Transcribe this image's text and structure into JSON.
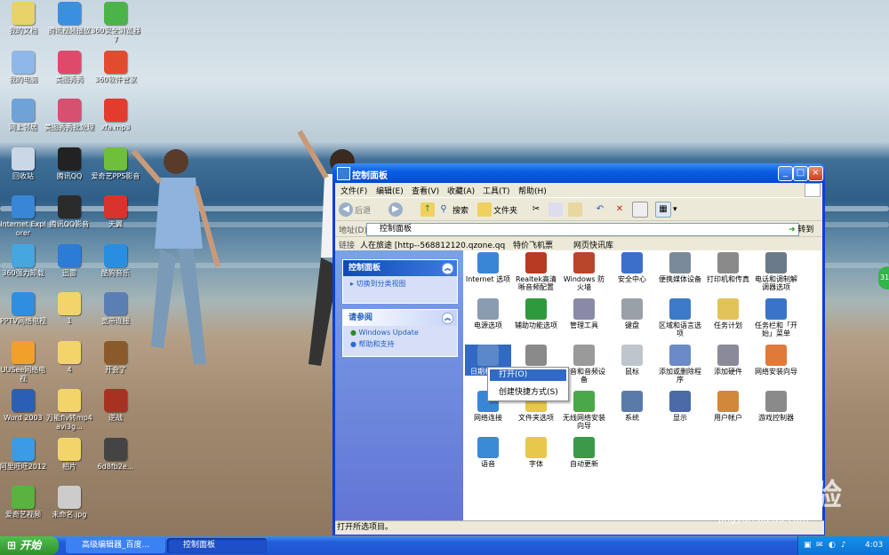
{
  "desktop_icons": [
    {
      "label": "我的文档",
      "color": "#e8d26a"
    },
    {
      "label": "我的电脑",
      "color": "#8fb8e8"
    },
    {
      "label": "网上邻居",
      "color": "#6fa3d8"
    },
    {
      "label": "回收站",
      "color": "#c9d7e6"
    },
    {
      "label": "Internet Explorer",
      "color": "#3a86d6"
    },
    {
      "label": "360强力卸载",
      "color": "#45a6e0"
    },
    {
      "label": "PPTV网络电视",
      "color": "#2f8ee0"
    },
    {
      "label": "UUSee网络电视",
      "color": "#f1a12b"
    },
    {
      "label": "Word 2003",
      "color": "#2b5fb5"
    },
    {
      "label": "阿里旺旺2012",
      "color": "#3b9be6"
    },
    {
      "label": "爱奇艺视频",
      "color": "#5ab33e"
    },
    {
      "label": "腾讯视频播放",
      "color": "#3a8fe0"
    },
    {
      "label": "美图秀秀",
      "color": "#e04a6a"
    },
    {
      "label": "美图秀秀批处理",
      "color": "#d6506f"
    },
    {
      "label": "腾讯QQ",
      "color": "#222222"
    },
    {
      "label": "腾讯QQ影音",
      "color": "#2b2b2b"
    },
    {
      "label": "迅雷",
      "color": "#2c7bd6"
    },
    {
      "label": "1",
      "color": "#f2d46b"
    },
    {
      "label": "4",
      "color": "#f2d46b"
    },
    {
      "label": "万能flv转mp4avi3g...",
      "color": "#f2d46b"
    },
    {
      "label": "相片",
      "color": "#f2d46b"
    },
    {
      "label": "未命名.jpg",
      "color": "#cccccc"
    },
    {
      "label": "360安全浏览器7",
      "color": "#4bb449"
    },
    {
      "label": "360软件管家",
      "color": "#e34b2e"
    },
    {
      "label": "xfa.mp3",
      "color": "#e33b2e"
    },
    {
      "label": "爱奇艺PPS影音",
      "color": "#6fbf3b"
    },
    {
      "label": "天翼",
      "color": "#d9342b"
    },
    {
      "label": "酷狗音乐",
      "color": "#2a8ee0"
    },
    {
      "label": "宽带连接",
      "color": "#5b7fb5"
    },
    {
      "label": "开会了",
      "color": "#8a5a2b"
    },
    {
      "label": "逆战",
      "color": "#a83222"
    },
    {
      "label": "6d8fb2e...",
      "color": "#444444"
    }
  ],
  "window": {
    "title": "控制面板",
    "menu": [
      "文件(F)",
      "编辑(E)",
      "查看(V)",
      "收藏(A)",
      "工具(T)",
      "帮助(H)"
    ],
    "toolbar": {
      "back": "后退",
      "search": "搜索",
      "folders": "文件夹"
    },
    "address_label": "地址(D)",
    "address_value": "控制面板",
    "go_label": "转到",
    "links_label": "链接",
    "links": [
      "人在旅途 [http--568812120.qzone.qq",
      "特价飞机票",
      "网页快讯库"
    ],
    "side": {
      "cp_title": "控制面板",
      "cp_switch": "切换到分类视图",
      "see_also_title": "请参阅",
      "see_also_items": [
        "Windows Update",
        "帮助和支持"
      ]
    },
    "items": [
      {
        "label": "Internet 选项",
        "color": "#3a86d6"
      },
      {
        "label": "Realtek高清晰音频配置",
        "color": "#b83a22"
      },
      {
        "label": "Windows 防火墙",
        "color": "#b9452a"
      },
      {
        "label": "安全中心",
        "color": "#3b6fc9"
      },
      {
        "label": "便携媒体设备",
        "color": "#7a8a9a"
      },
      {
        "label": "打印机和传真",
        "color": "#8a8a8a"
      },
      {
        "label": "电话和调制解调器选项",
        "color": "#6a7a8a"
      },
      {
        "label": "电源选项",
        "color": "#8a9cb0"
      },
      {
        "label": "辅助功能选项",
        "color": "#2f9a3c"
      },
      {
        "label": "管理工具",
        "color": "#8a8aa8"
      },
      {
        "label": "键盘",
        "color": "#9aa0a8"
      },
      {
        "label": "区域和语言选项",
        "color": "#3d7ac8"
      },
      {
        "label": "任务计划",
        "color": "#e2c25a"
      },
      {
        "label": "任务栏和「开始」菜单",
        "color": "#3a74c8"
      },
      {
        "label": "日期和时间",
        "color": "#5a88c8"
      },
      {
        "label": "扫描仪和照相机",
        "color": "#8a8a8a"
      },
      {
        "label": "声音和音频设备",
        "color": "#9a9a9a"
      },
      {
        "label": "鼠标",
        "color": "#bfc5cc"
      },
      {
        "label": "添加或删除程序",
        "color": "#6a8ac8"
      },
      {
        "label": "添加硬件",
        "color": "#8a8a9a"
      },
      {
        "label": "网络安装向导",
        "color": "#e07a3a"
      },
      {
        "label": "网络连接",
        "color": "#3a86d6"
      },
      {
        "label": "文件夹选项",
        "color": "#e8c84a"
      },
      {
        "label": "无线网络安装向导",
        "color": "#4aa84a"
      },
      {
        "label": "系统",
        "color": "#5a7aa8"
      },
      {
        "label": "显示",
        "color": "#4a6aa8"
      },
      {
        "label": "用户帐户",
        "color": "#d2883a"
      },
      {
        "label": "游戏控制器",
        "color": "#8a8a8a"
      },
      {
        "label": "语音",
        "color": "#3a8ad6"
      },
      {
        "label": "字体",
        "color": "#e8c84a"
      },
      {
        "label": "自动更新",
        "color": "#3a9a4a"
      }
    ],
    "status": "打开所选项目。"
  },
  "context_menu": {
    "open": "打开(O)",
    "shortcut": "创建快捷方式(S)"
  },
  "taskbar": {
    "start": "开始",
    "tasks": [
      "高级编辑器_百度...",
      "控制面板"
    ],
    "clock": "4:03"
  },
  "watermark": {
    "main": "Baidu经验",
    "sub": "jingyan.baidu.com"
  },
  "edge_badge": "31"
}
